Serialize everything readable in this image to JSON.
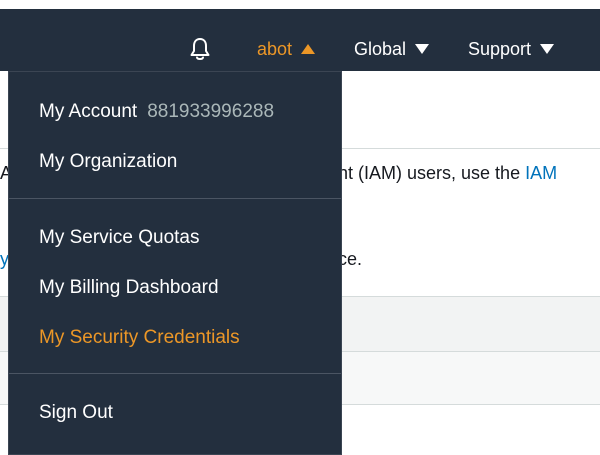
{
  "header": {
    "notifications_icon": "bell-icon",
    "account_label": "abot",
    "region_label": "Global",
    "support_label": "Support"
  },
  "background": {
    "line1_text": "ent (IAM) users, use the ",
    "line1_link": "IAM",
    "line1_left_fragment": "A",
    "line2_text": "nce.",
    "line2_left_fragment": "y"
  },
  "dropdown": {
    "account": {
      "label": "My Account",
      "account_id": "881933996288"
    },
    "organization_label": "My Organization",
    "service_quotas_label": "My Service Quotas",
    "billing_label": "My Billing Dashboard",
    "security_credentials_label": "My Security Credentials",
    "sign_out_label": "Sign Out"
  },
  "colors": {
    "nav_background": "#232f3e",
    "accent_orange": "#ec9727",
    "link_blue": "#0073bb",
    "muted_text": "#aab7b8"
  }
}
